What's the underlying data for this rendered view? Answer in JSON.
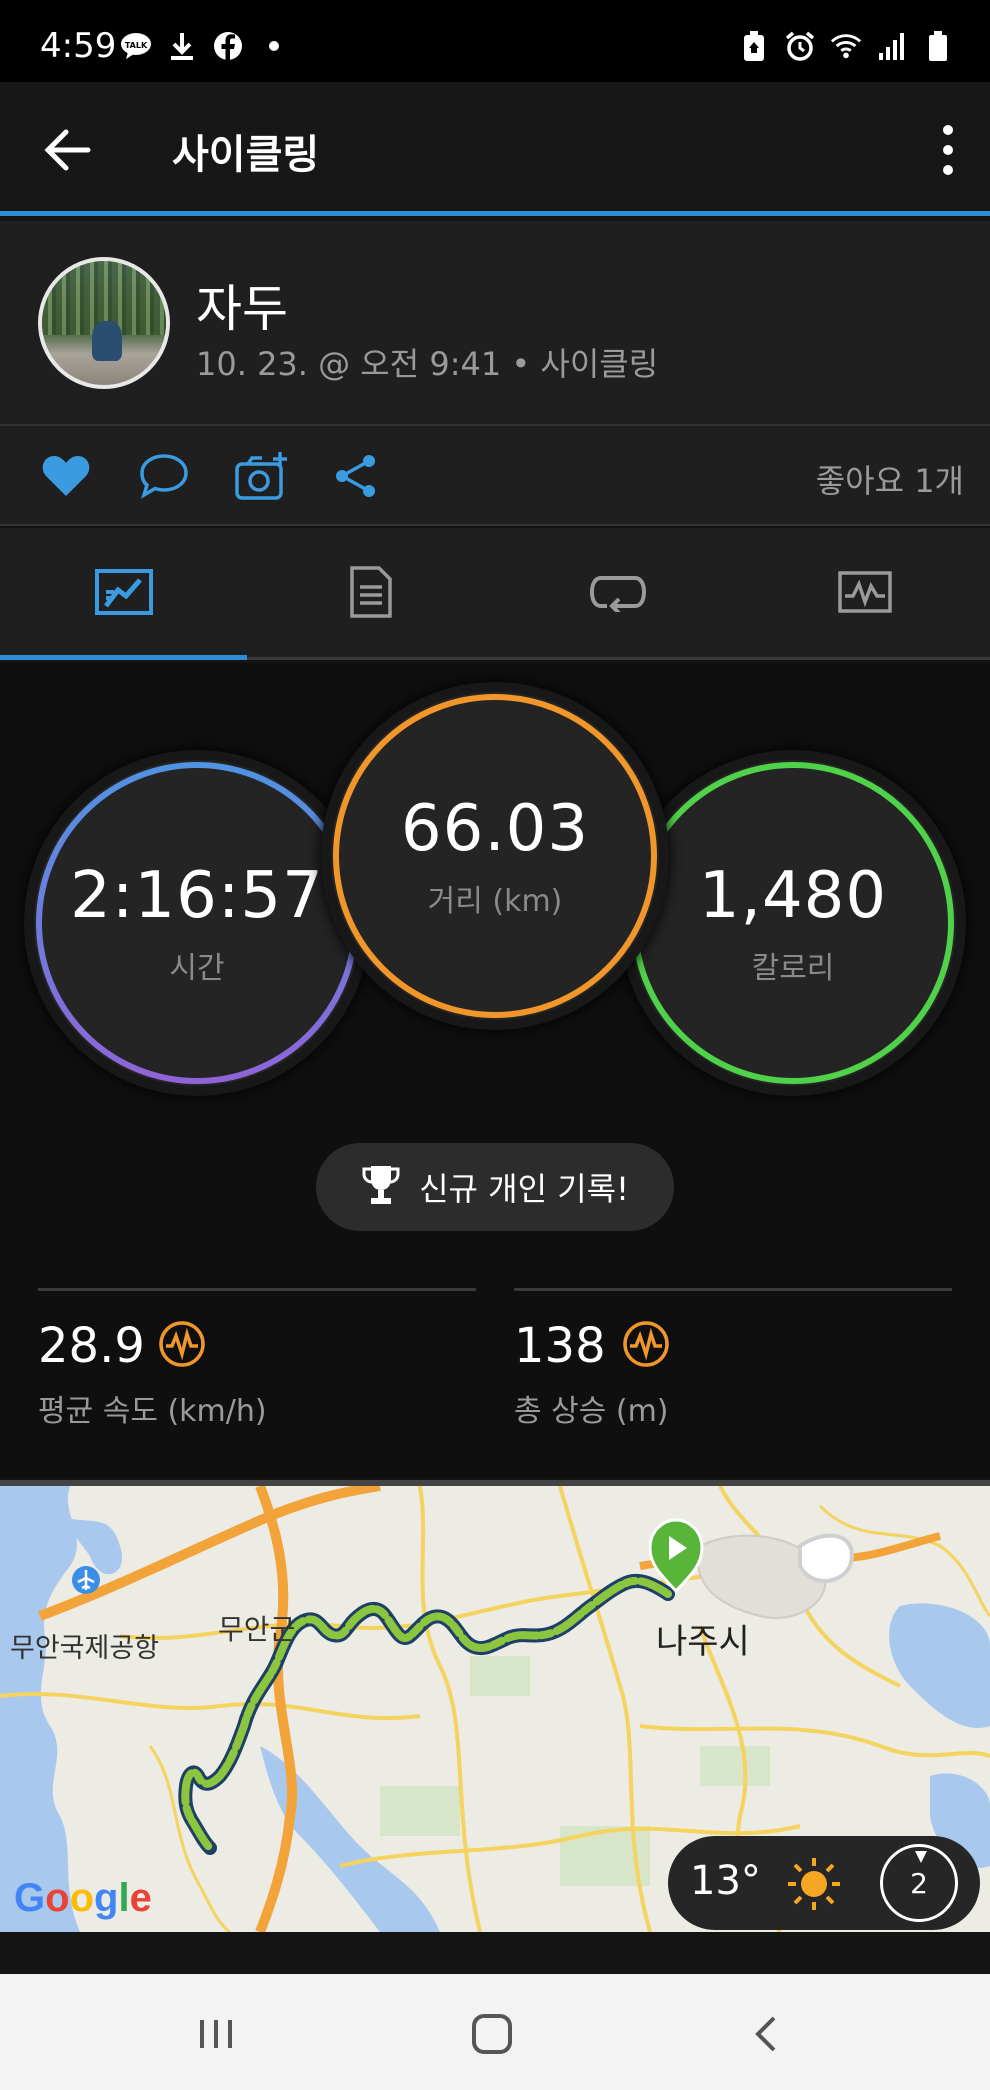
{
  "status_bar": {
    "time": "4:59",
    "left_icons": [
      "talk-icon",
      "download-icon",
      "facebook-icon",
      "dot-icon"
    ],
    "right_icons": [
      "battery-saver-icon",
      "alarm-icon",
      "wifi-icon",
      "signal-icon",
      "battery-icon"
    ]
  },
  "app_bar": {
    "title": "사이클링"
  },
  "profile": {
    "name": "자두",
    "subtitle": "10. 23. @ 오전 9:41 • 사이클링"
  },
  "actions": {
    "likes_label": "좋아요 1개"
  },
  "tabs": [
    {
      "icon": "stats-chart-icon",
      "selected": true
    },
    {
      "icon": "document-icon",
      "selected": false
    },
    {
      "icon": "laps-icon",
      "selected": false
    },
    {
      "icon": "graph-icon",
      "selected": false
    }
  ],
  "circles": {
    "time": {
      "value": "2:16:57",
      "label": "시간"
    },
    "distance": {
      "value": "66.03",
      "label": "거리 (km)"
    },
    "calories": {
      "value": "1,480",
      "label": "칼로리"
    }
  },
  "personal_record": {
    "label": "신규 개인 기록!"
  },
  "metrics": {
    "avg_speed": {
      "value": "28.9",
      "label": "평균 속도 (km/h)"
    },
    "total_ascent": {
      "value": "138",
      "label": "총 상승 (m)"
    }
  },
  "map": {
    "labels": {
      "airport": "무안국제공항",
      "county": "무안군",
      "city": "나주시"
    },
    "attribution": "Google",
    "weather": {
      "temp": "13°",
      "wind": "2"
    }
  },
  "colors": {
    "accent": "#2f8fd6",
    "time_ring": "#5a8fe0",
    "distance_ring": "#f0962a",
    "calories_ring": "#4fd14a",
    "metric_icon": "#f0962a"
  }
}
